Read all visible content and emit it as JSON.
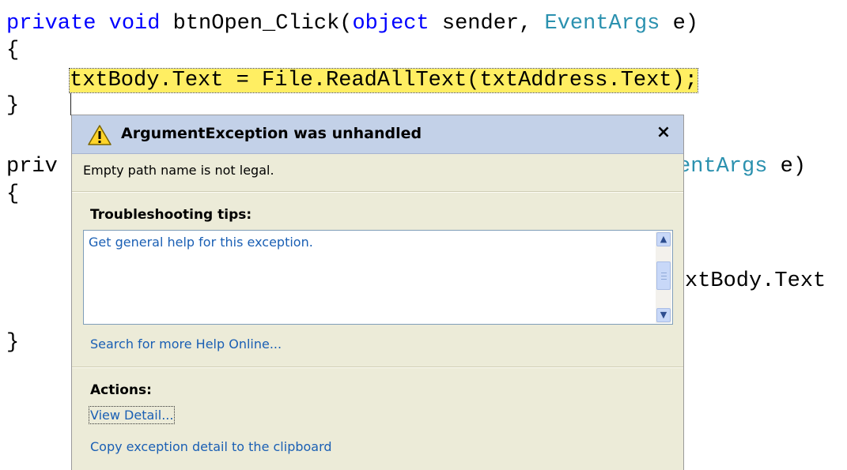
{
  "code": {
    "line1": {
      "kw1": "private",
      "kw2": "void",
      "mid": "btnOpen_Click(",
      "kw3": "object",
      "mid2": "sender,",
      "type": "EventArgs",
      "end": "e)"
    },
    "line2": "{",
    "line3": {
      "highlighted": "txtBody.Text = File.ReadAllText(txtAddress.Text);"
    },
    "line4": "}",
    "line5": {
      "visible_left": "priv",
      "visible_right_type": "entArgs",
      "visible_right_end": "e)"
    },
    "line6": "{",
    "line7_right": "xtBody.Text",
    "line8": "}"
  },
  "exception": {
    "title": "ArgumentException was unhandled",
    "close": "×",
    "message": "Empty path name is not legal.",
    "tips_heading": "Troubleshooting tips:",
    "tips": [
      "Get general help for this exception."
    ],
    "help_online": "Search for more Help Online...",
    "actions_heading": "Actions:",
    "actions": [
      "View Detail...",
      "Copy exception detail to the clipboard"
    ]
  },
  "colors": {
    "keyword": "#0000ff",
    "type": "#2b91af",
    "highlight": "#ffee62",
    "dialog_bg": "#ecebd8",
    "header_bg": "#c3d1e8",
    "link": "#1a5fb4"
  },
  "icons": {
    "warning": "warning-icon",
    "close": "close-icon",
    "scroll_up": "scroll-up-icon",
    "scroll_down": "scroll-down-icon"
  }
}
